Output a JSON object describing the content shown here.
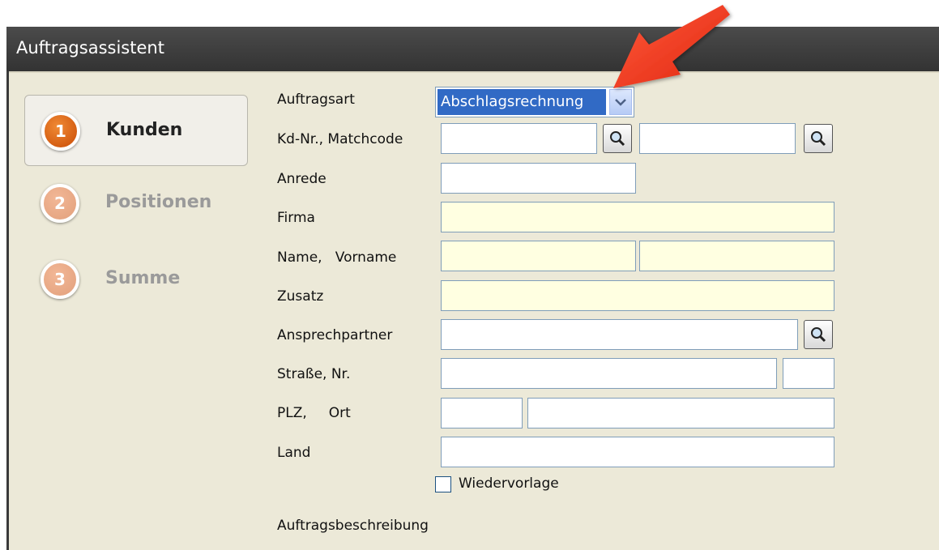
{
  "window": {
    "title": "Auftragsassistent"
  },
  "steps": [
    {
      "number": "1",
      "label": "Kunden",
      "active": true
    },
    {
      "number": "2",
      "label": "Positionen",
      "active": false
    },
    {
      "number": "3",
      "label": "Summe",
      "active": false
    }
  ],
  "form": {
    "auftragsart": {
      "label": "Auftragsart",
      "value": "Abschlagsrechnung"
    },
    "kdnr": {
      "label": "Kd-Nr., Matchcode",
      "kdnr_value": "",
      "matchcode_value": ""
    },
    "anrede": {
      "label": "Anrede",
      "value": ""
    },
    "firma": {
      "label": "Firma",
      "value": ""
    },
    "name": {
      "label": "Name,   Vorname",
      "name_value": "",
      "vorname_value": ""
    },
    "zusatz": {
      "label": "Zusatz",
      "value": ""
    },
    "ansprechpartner": {
      "label": "Ansprechpartner",
      "value": ""
    },
    "strasse": {
      "label": "Straße, Nr.",
      "strasse_value": "",
      "nr_value": ""
    },
    "plz": {
      "label": "PLZ,     Ort",
      "plz_value": "",
      "ort_value": ""
    },
    "land": {
      "label": "Land",
      "value": ""
    },
    "wiedervorlage": {
      "label": "Wiedervorlage",
      "checked": false
    },
    "auftragsbeschreibung": {
      "label": "Auftragsbeschreibung"
    }
  },
  "icons": {
    "search": "magnifier-icon",
    "dropdown": "chevron-down-icon",
    "annotation": "red-arrow-icon"
  },
  "colors": {
    "titlebar": "#3a3a3a",
    "window_bg": "#ece9d8",
    "active_step": "#e0620d",
    "inactive_step": "#eaa983",
    "required_field": "#ffffe1",
    "selection": "#316ac5",
    "arrow": "#ee3322"
  }
}
